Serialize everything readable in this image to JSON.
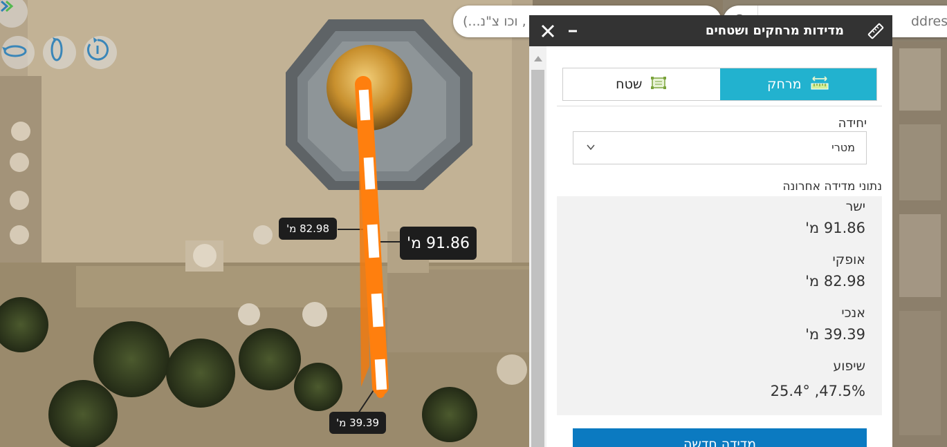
{
  "search": {
    "left_placeholder": "(...וכו צ\"נ ,",
    "right_placeholder": "ddress or"
  },
  "map": {
    "horizontal_label": "82.98 מ'",
    "straight_label": "91.86 מ'",
    "vertical_label": "39.39 מ'",
    "line_color": "#ff7f0e"
  },
  "panel": {
    "title": "מדידות מרחקים ושטחים",
    "minimize_symbol": "–",
    "close_symbol": "✕",
    "tabs": [
      {
        "label": "שטח",
        "icon": "area-icon",
        "active": false
      },
      {
        "label": "מרחק",
        "icon": "distance-icon",
        "active": true
      }
    ],
    "unit_label": "יחידה",
    "unit_value": "מטרי",
    "last_measure_label": "נתוני מדידה אחרונה",
    "results": [
      {
        "label": "ישר",
        "value": "91.86 מ'"
      },
      {
        "label": "אופקי",
        "value": "82.98 מ'"
      },
      {
        "label": "אנכי",
        "value": "39.39 מ'"
      },
      {
        "label": "שיפוע",
        "value": "25.4° ,47.5%"
      }
    ],
    "new_measure_button": "מדידה חדשה"
  },
  "colors": {
    "panel_header": "#333333",
    "tab_active": "#22b2cf",
    "button": "#0b7ac1",
    "measure_line": "#ff7f0e"
  }
}
